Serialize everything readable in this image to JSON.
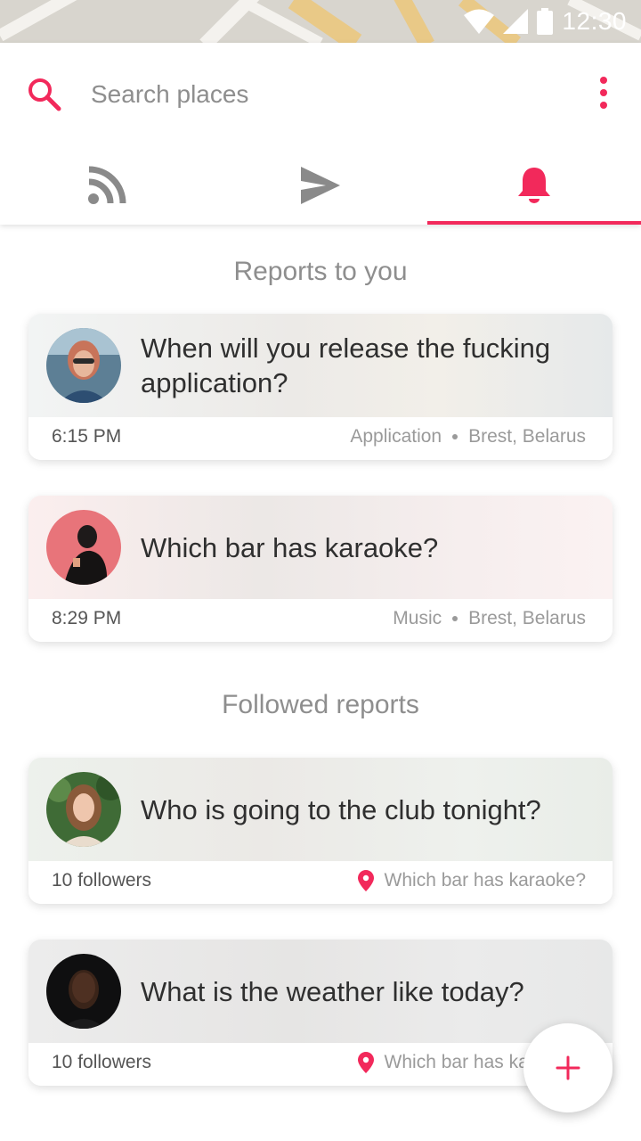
{
  "status_bar": {
    "time": "12:30"
  },
  "search": {
    "placeholder": "Search places"
  },
  "tabs": [
    {
      "name": "feed",
      "icon": "rss-icon",
      "active": false
    },
    {
      "name": "send",
      "icon": "send-icon",
      "active": false
    },
    {
      "name": "notifications",
      "icon": "bell-icon",
      "active": true
    }
  ],
  "sections": {
    "reports_to_you": "Reports to you",
    "followed_reports": "Followed reports"
  },
  "reports": [
    {
      "question": "When will you release the fucking application?",
      "time": "6:15 PM",
      "category": "Application",
      "location": "Brest, Belarus"
    },
    {
      "question": "Which bar has karaoke?",
      "time": "8:29 PM",
      "category": "Music",
      "location": "Brest, Belarus"
    }
  ],
  "followed": [
    {
      "question": "Who is going to the club tonight?",
      "followers": "10 followers",
      "place": "Which bar has karaoke?"
    },
    {
      "question": "What is the weather like today?",
      "followers": "10 followers",
      "place": "Which bar has karaoke?"
    }
  ],
  "colors": {
    "accent": "#f2295b",
    "icon_gray": "#8a8a8a"
  },
  "fab": {
    "icon": "plus-icon"
  }
}
